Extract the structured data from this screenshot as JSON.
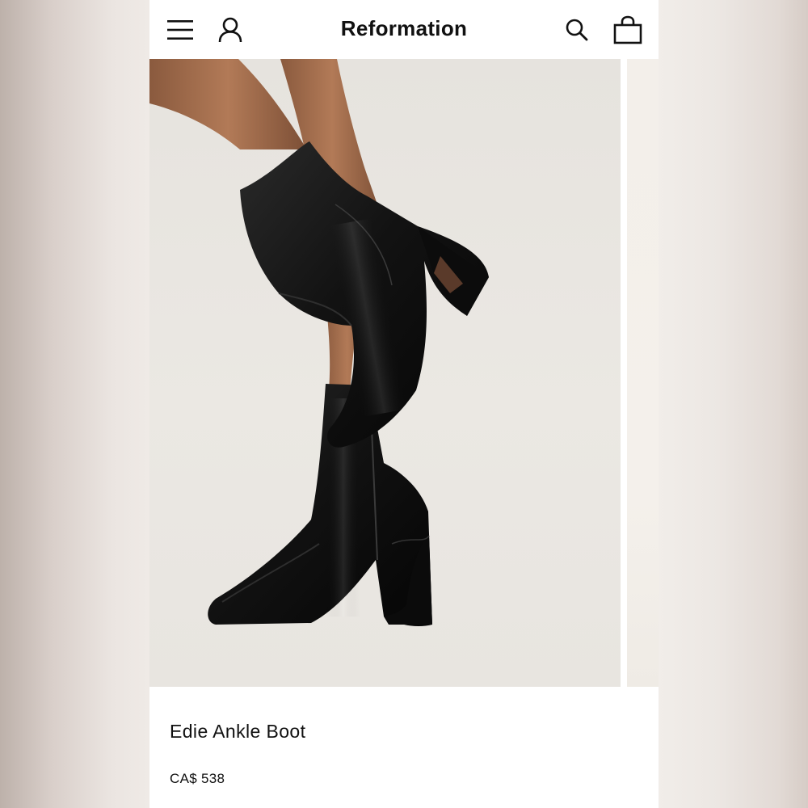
{
  "header": {
    "brand": "Reformation",
    "menu_icon": "hamburger-menu-icon",
    "account_icon": "user-account-icon",
    "search_icon": "search-icon",
    "bag_icon": "shopping-bag-icon"
  },
  "product": {
    "name": "Edie Ankle Boot",
    "price": "CA$ 538",
    "image_alt": "black leather square-toe ankle boots with flared heel"
  },
  "colors": {
    "background": "#ffffff",
    "text": "#111111",
    "image_backdrop": "#e8e5e0"
  }
}
